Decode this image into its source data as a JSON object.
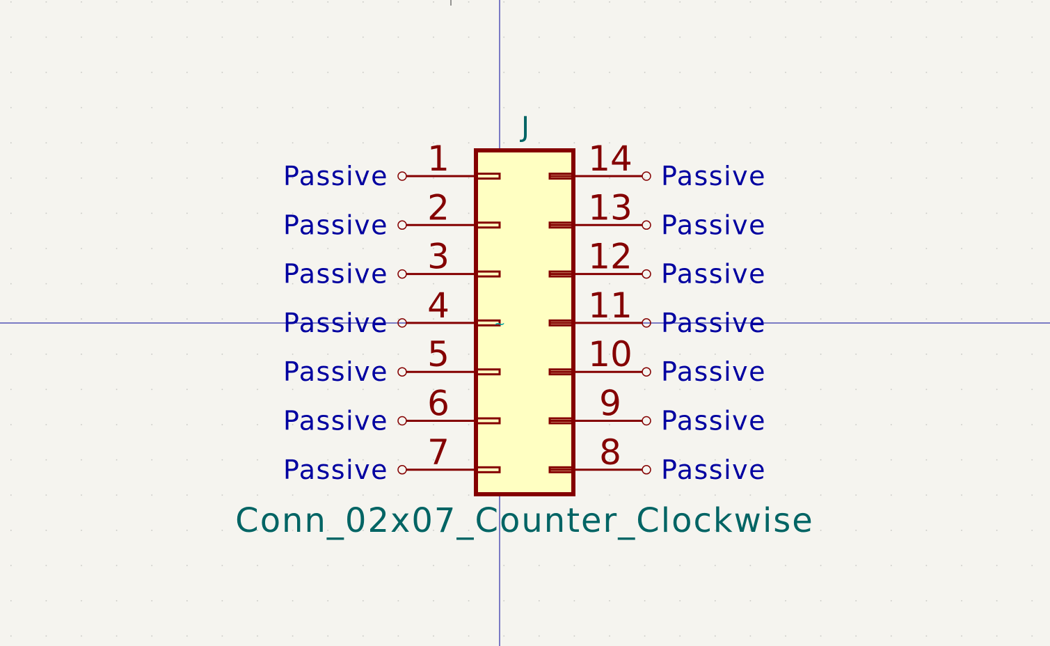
{
  "symbol": {
    "reference": "J",
    "value": "Conn_02x07_Counter_Clockwise",
    "body_fill": "#ffffc2",
    "outline_color": "#840000",
    "pin_color": "#840000",
    "pin_text_color": "#0000a0",
    "field_text_color": "#006464",
    "crosshair_color": "#00009a",
    "background_color": "#f5f4ef",
    "left_pins": [
      {
        "number": "1",
        "type": "Passive"
      },
      {
        "number": "2",
        "type": "Passive"
      },
      {
        "number": "3",
        "type": "Passive"
      },
      {
        "number": "4",
        "type": "Passive"
      },
      {
        "number": "5",
        "type": "Passive"
      },
      {
        "number": "6",
        "type": "Passive"
      },
      {
        "number": "7",
        "type": "Passive"
      }
    ],
    "right_pins": [
      {
        "number": "14",
        "type": "Passive"
      },
      {
        "number": "13",
        "type": "Passive"
      },
      {
        "number": "12",
        "type": "Passive"
      },
      {
        "number": "11",
        "type": "Passive"
      },
      {
        "number": "10",
        "type": "Passive"
      },
      {
        "number": "9",
        "type": "Passive"
      },
      {
        "number": "8",
        "type": "Passive"
      }
    ],
    "anchor_marker": "~"
  }
}
